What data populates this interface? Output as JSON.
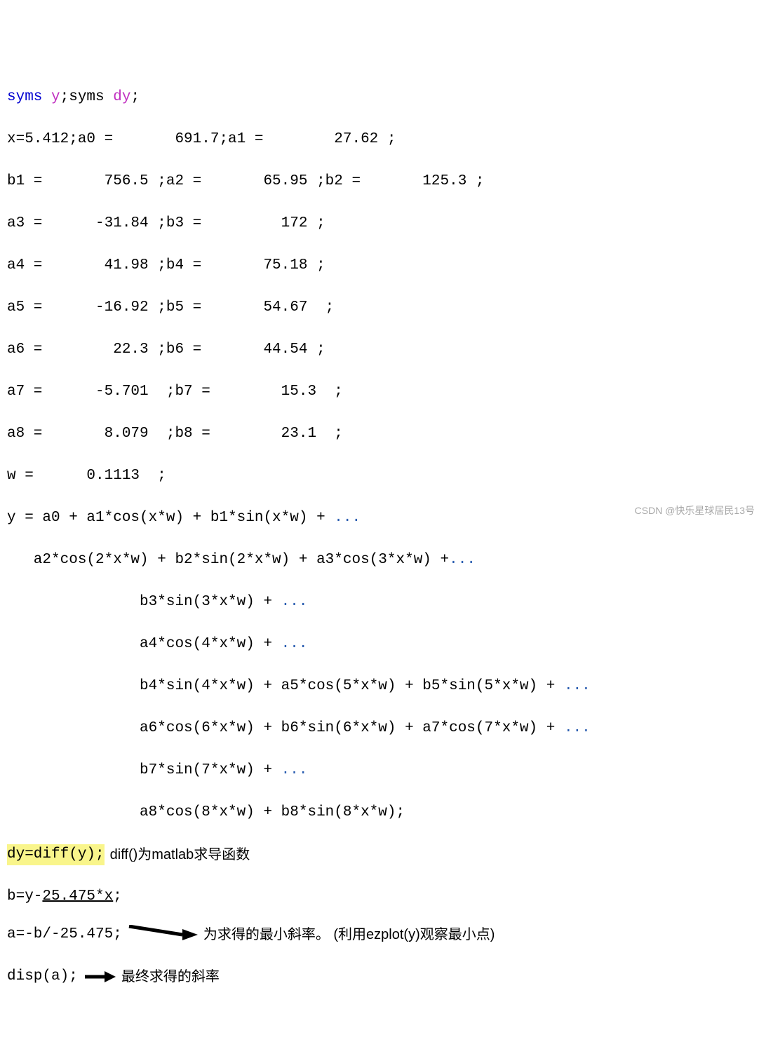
{
  "code": {
    "l1_a": "syms ",
    "l1_sym1": "y",
    "l1_b": ";syms ",
    "l1_sym2": "dy",
    "l1_c": ";",
    "l2": "x=5.412;a0 =       691.7;a1 =        27.62 ;",
    "l3": "b1 =       756.5 ;a2 =       65.95 ;b2 =       125.3 ;",
    "l4": "a3 =      -31.84 ;b3 =         172 ;",
    "l5": "a4 =       41.98 ;b4 =       75.18 ;",
    "l6": "a5 =      -16.92 ;b5 =       54.67  ;",
    "l7": "a6 =        22.3 ;b6 =       44.54 ;",
    "l8": "a7 =      -5.701  ;b7 =        15.3  ;",
    "l9": "a8 =       8.079  ;b8 =        23.1  ;",
    "l10": "w =      0.1113  ;",
    "l11": "y = a0 + a1*cos(x*w) + b1*sin(x*w) + ",
    "l12": "   a2*cos(2*x*w) + b2*sin(2*x*w) + a3*cos(3*x*w) +",
    "l13": "               b3*sin(3*x*w) + ",
    "l14": "               a4*cos(4*x*w) + ",
    "l15": "               b4*sin(4*x*w) + a5*cos(5*x*w) + b5*sin(5*x*w) + ",
    "l16": "               a6*cos(6*x*w) + b6*sin(6*x*w) + a7*cos(7*x*w) + ",
    "l17": "               b7*sin(7*x*w) + ",
    "l18": "               a8*cos(8*x*w) + b8*sin(8*x*w);",
    "dots": "...",
    "l19": "dy=diff(y);",
    "l20a": "b=y-",
    "l20b": "25.475*x",
    "l20c": ";",
    "l21": "a=-b/-25.475;",
    "l22": "disp(a);"
  },
  "annot": {
    "diff_note": "diff()为matlab求导函数",
    "slope_note": "为求得的最小斜率。   (利用ezplot(y)观察最小点)",
    "final_note": "最终求得的斜率"
  },
  "watermark": "CSDN @快乐星球居民13号"
}
